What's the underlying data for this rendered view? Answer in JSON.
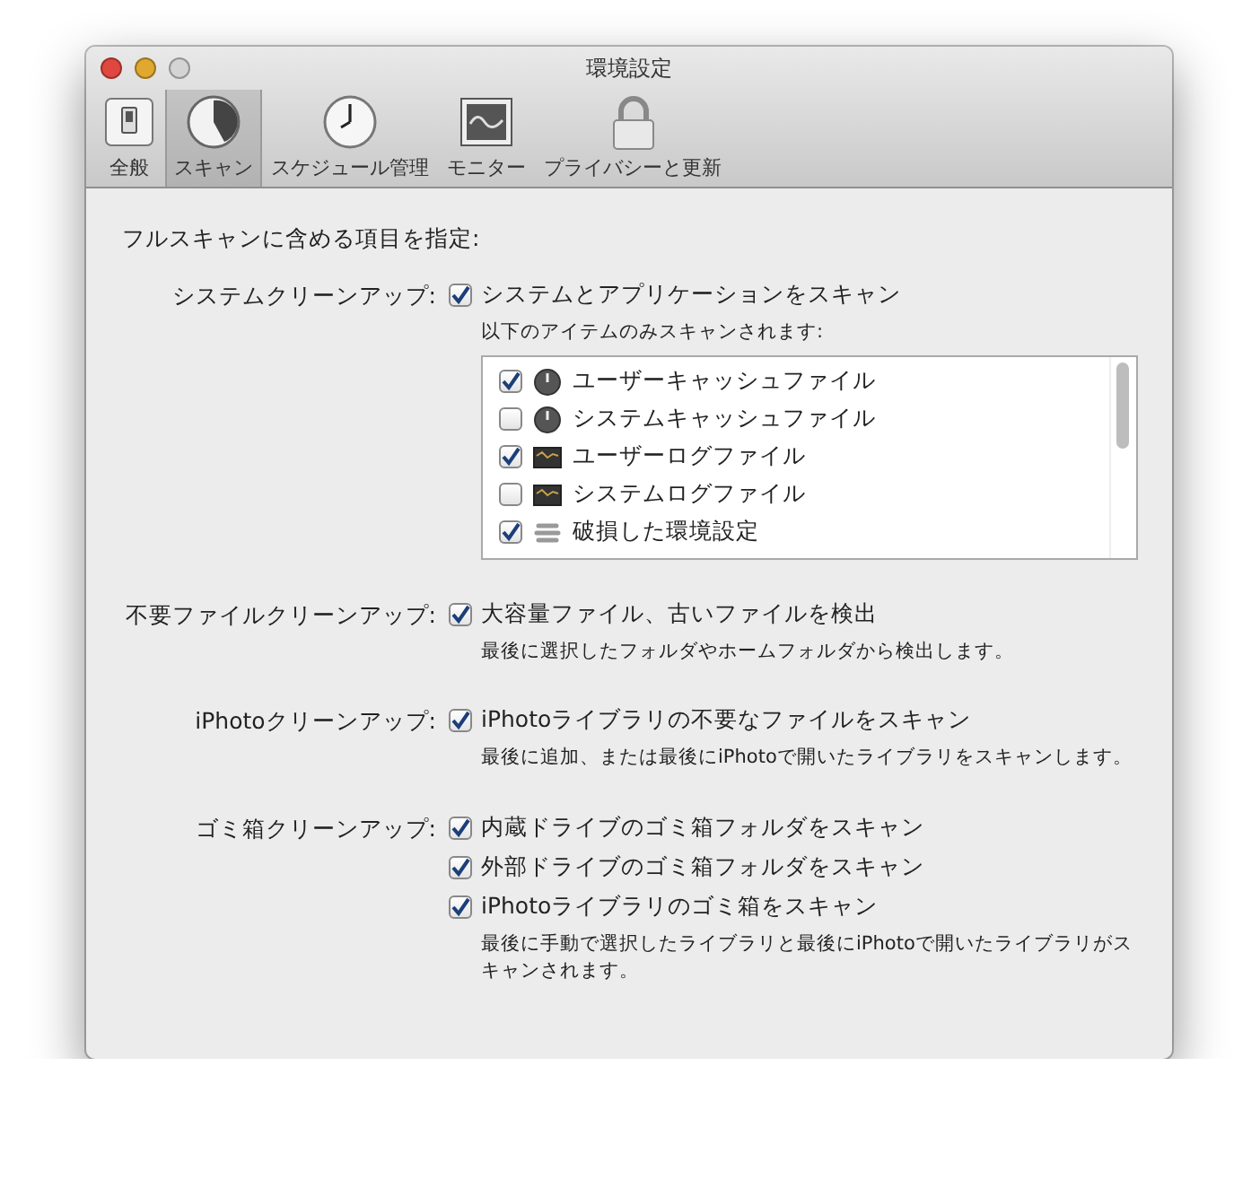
{
  "window": {
    "title": "環境設定"
  },
  "toolbar": {
    "items": [
      {
        "label": "全般",
        "kind": "general",
        "selected": false
      },
      {
        "label": "スキャン",
        "kind": "scan",
        "selected": true
      },
      {
        "label": "スケジュール管理",
        "kind": "schedule",
        "selected": false
      },
      {
        "label": "モニター",
        "kind": "monitor",
        "selected": false
      },
      {
        "label": "プライバシーと更新",
        "kind": "privacy",
        "selected": false
      }
    ]
  },
  "heading": "フルスキャンに含める項目を指定:",
  "sections": [
    {
      "label": "システムクリーンアップ:",
      "options": [
        {
          "label": "システムとアプリケーションをスキャン",
          "checked": true
        }
      ],
      "note": "以下のアイテムのみスキャンされます:",
      "list": [
        {
          "label": "ユーザーキャッシュファイル",
          "kind": "cache",
          "checked": true
        },
        {
          "label": "システムキャッシュファイル",
          "kind": "cache",
          "checked": false
        },
        {
          "label": "ユーザーログファイル",
          "kind": "log",
          "checked": true
        },
        {
          "label": "システムログファイル",
          "kind": "log",
          "checked": false
        },
        {
          "label": "破損した環境設定",
          "kind": "prefs",
          "checked": true
        }
      ]
    },
    {
      "label": "不要ファイルクリーンアップ:",
      "options": [
        {
          "label": "大容量ファイル、古いファイルを検出",
          "checked": true
        }
      ],
      "note": "最後に選択したフォルダやホームフォルダから検出します。"
    },
    {
      "label": "iPhotoクリーンアップ:",
      "options": [
        {
          "label": "iPhotoライブラリの不要なファイルをスキャン",
          "checked": true
        }
      ],
      "note": "最後に追加、または最後にiPhotoで開いたライブラリをスキャンします。"
    },
    {
      "label": "ゴミ箱クリーンアップ:",
      "options": [
        {
          "label": "内蔵ドライブのゴミ箱フォルダをスキャン",
          "checked": true
        },
        {
          "label": "外部ドライブのゴミ箱フォルダをスキャン",
          "checked": true
        },
        {
          "label": "iPhotoライブラリのゴミ箱をスキャン",
          "checked": true
        }
      ],
      "note": "最後に手動で選択したライブラリと最後にiPhotoで開いたライブラリがスキャンされます。"
    }
  ]
}
